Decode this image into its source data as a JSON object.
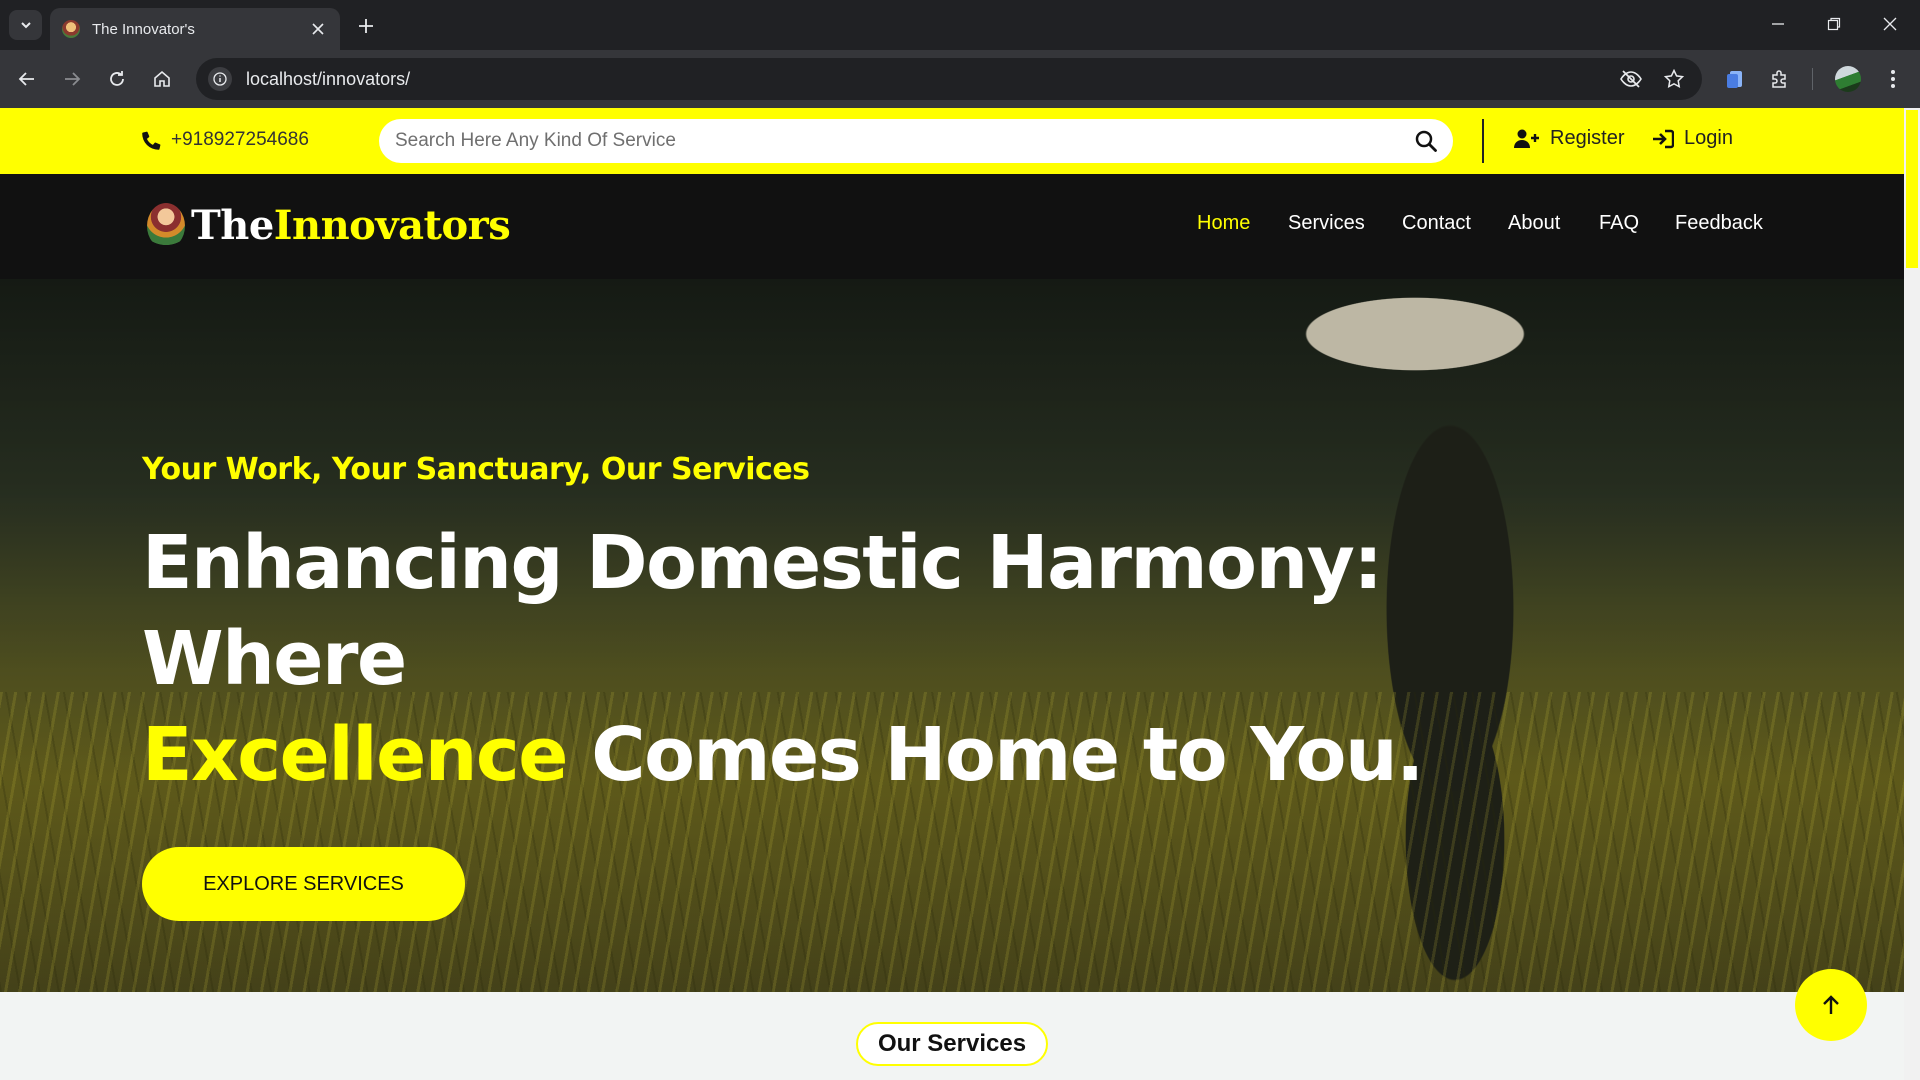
{
  "browser": {
    "tab_title": "The Innovator's",
    "url": "localhost/innovators/"
  },
  "topbar": {
    "phone": "+918927254686",
    "search_placeholder": "Search Here Any Kind Of Service",
    "register_label": "Register",
    "login_label": "Login",
    "accent_color": "#ffff00"
  },
  "navbar": {
    "logo_part1": "The",
    "logo_part2": "Innovators",
    "menu": [
      {
        "label": "Home",
        "active": true
      },
      {
        "label": "Services",
        "active": false
      },
      {
        "label": "Contact",
        "active": false
      },
      {
        "label": "About",
        "active": false
      },
      {
        "label": "FAQ",
        "active": false
      },
      {
        "label": "Feedback",
        "active": false
      }
    ]
  },
  "hero": {
    "subtitle": "Your Work, Your Sanctuary, Our Services",
    "title_line1": "Enhancing Domestic Harmony: Where",
    "title_highlight": "Excellence",
    "title_line2_rest": " Comes Home to You.",
    "cta_label": "EXPLORE SERVICES"
  },
  "services": {
    "heading": "Our Services"
  },
  "icons": {
    "phone": "phone-icon",
    "search": "search-icon",
    "register": "user-plus-icon",
    "login": "sign-in-icon",
    "to_top": "arrow-up-icon"
  }
}
